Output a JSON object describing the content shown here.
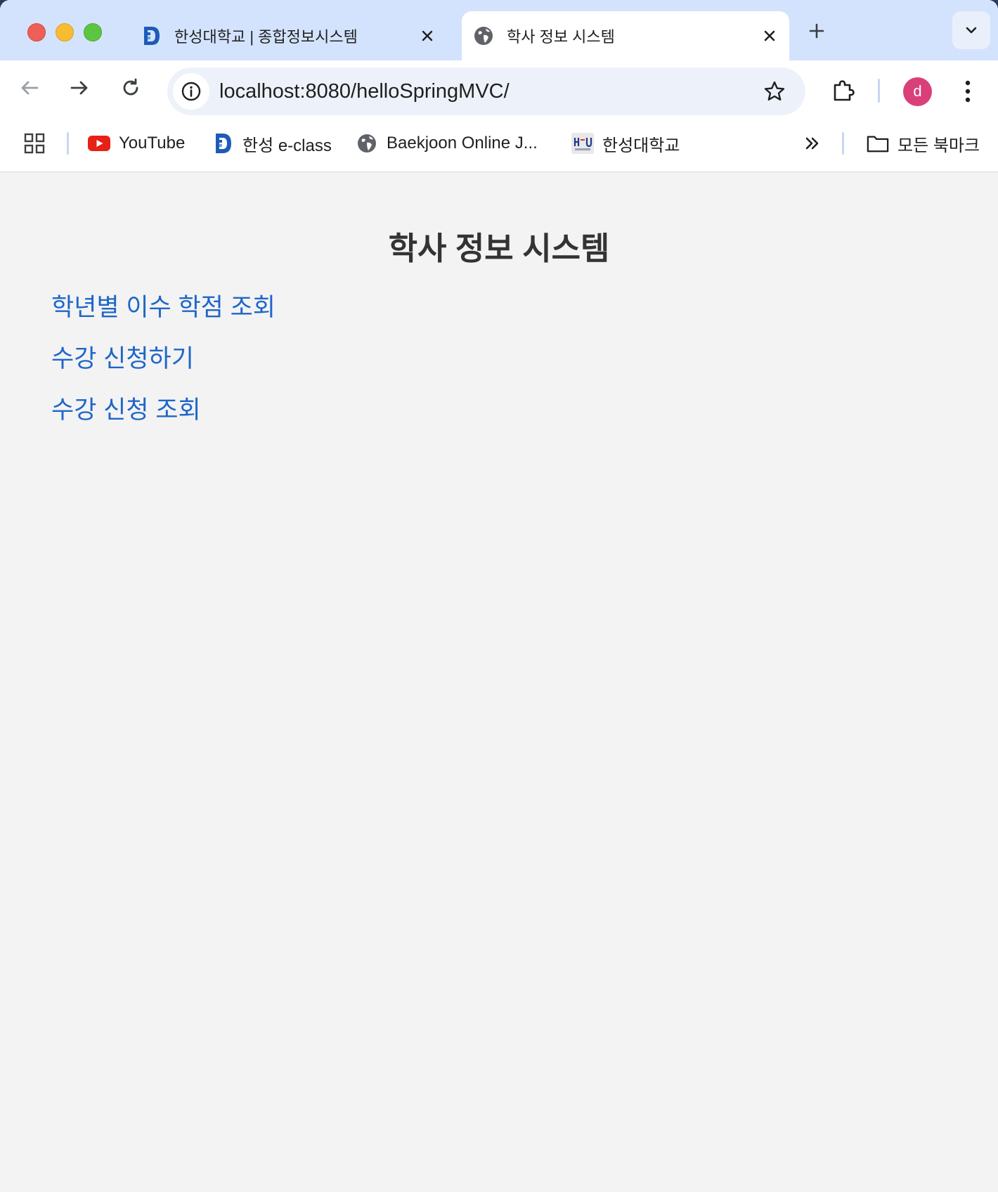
{
  "browser": {
    "tabs": [
      {
        "title": "한성대학교 | 종합정보시스템",
        "active": false,
        "favicon": "hansung-logo-icon"
      },
      {
        "title": "학사 정보 시스템",
        "active": true,
        "favicon": "globe-icon"
      }
    ],
    "address_bar": {
      "url": "localhost:8080/helloSpringMVC/"
    },
    "profile": {
      "initial": "d",
      "color": "#d9407a"
    },
    "bookmarks": [
      {
        "label": "YouTube",
        "icon": "youtube-icon"
      },
      {
        "label": "한성 e-class",
        "icon": "hansung-logo-icon"
      },
      {
        "label": "Baekjoon Online J...",
        "icon": "globe-icon"
      },
      {
        "label": "한성대학교",
        "icon": "hsu-logo-icon"
      }
    ],
    "all_bookmarks_label": "모든 북마크"
  },
  "page": {
    "heading": "학사 정보 시스템",
    "links": [
      {
        "label": "학년별 이수 학점 조회"
      },
      {
        "label": "수강 신청하기"
      },
      {
        "label": "수강 신청 조회"
      }
    ]
  },
  "colors": {
    "link": "#1f66c8",
    "tabstrip": "#d3e3fd",
    "page_background": "#f3f3f3"
  }
}
